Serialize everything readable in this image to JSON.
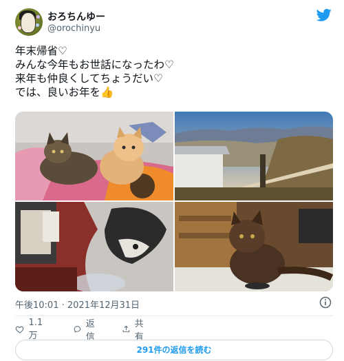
{
  "user": {
    "display_name": "おろちんゆー",
    "handle": "@orochinyu"
  },
  "tweet": {
    "lines": "年末帰省♡\nみんな今年もお世話になったわ♡\n来年も仲良くしてちょうだい♡\nでは、良いお年を👍",
    "timestamp": "午後10:01 · 2021年12月31日"
  },
  "actions": {
    "like_count": "1.1万",
    "reply_label": "返信",
    "share_label": "共有"
  },
  "replies_button": "291件の返信を読む",
  "colors": {
    "accent": "#1d9bf0",
    "text": "#0f1419",
    "muted": "#536471"
  },
  "icons": [
    "twitter-bird-icon",
    "info-icon",
    "heart-icon",
    "reply-icon",
    "share-icon"
  ]
}
